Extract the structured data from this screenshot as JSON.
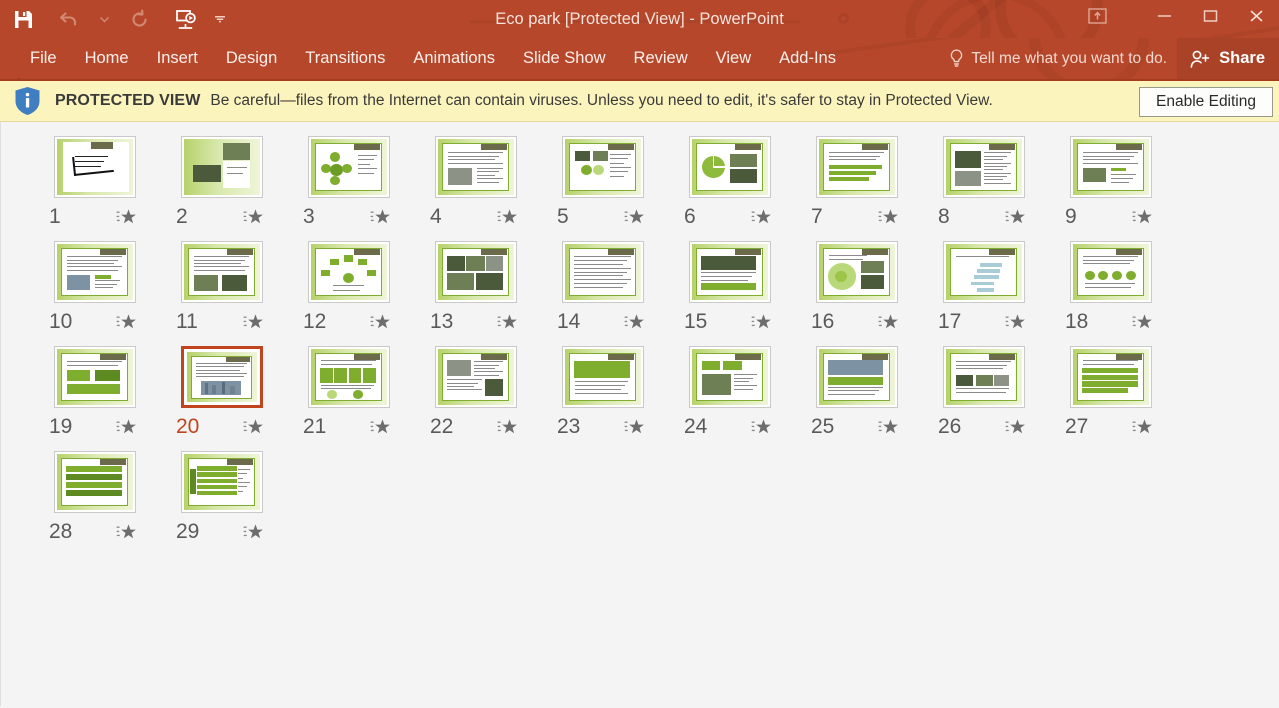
{
  "window": {
    "title": "Eco park [Protected View] - PowerPoint",
    "accent_color": "#b7472a",
    "controls": [
      {
        "name": "ribbon-display-options",
        "glyph": "ribbon"
      },
      {
        "name": "minimize",
        "glyph": "minimize"
      },
      {
        "name": "maximize",
        "glyph": "maximize"
      },
      {
        "name": "close",
        "glyph": "close"
      }
    ]
  },
  "quick_access": [
    {
      "name": "save",
      "label": "Save"
    },
    {
      "name": "undo",
      "label": "Undo",
      "disabled": true
    },
    {
      "name": "undo-dropdown",
      "label": "Undo options",
      "disabled": true
    },
    {
      "name": "redo",
      "label": "Redo",
      "disabled": true
    },
    {
      "name": "start-slideshow",
      "label": "Start From Beginning"
    },
    {
      "name": "customize-qat",
      "label": "Customize Quick Access Toolbar"
    }
  ],
  "ribbon": {
    "tabs": [
      {
        "label": "File",
        "active": false
      },
      {
        "label": "Home",
        "active": false
      },
      {
        "label": "Insert",
        "active": false
      },
      {
        "label": "Design",
        "active": false
      },
      {
        "label": "Transitions",
        "active": false
      },
      {
        "label": "Animations",
        "active": false
      },
      {
        "label": "Slide Show",
        "active": false
      },
      {
        "label": "Review",
        "active": false
      },
      {
        "label": "View",
        "active": false
      },
      {
        "label": "Add-Ins",
        "active": false
      }
    ],
    "tell_me": "Tell me what you want to do.",
    "share_label": "Share"
  },
  "protected_view": {
    "badge": "PROTECTED VIEW",
    "message": "Be careful—files from the Internet can contain viruses. Unless you need to edit, it's safer to stay in Protected View.",
    "button_label": "Enable Editing",
    "background_color": "#fcf4bd",
    "shield_color": "#3f7fc1"
  },
  "slide_sorter": {
    "selected_slide": 20,
    "total_slides": 29,
    "selection_color": "#c0451f",
    "slides": [
      {
        "number": "1",
        "layout": "calligraphy"
      },
      {
        "number": "2",
        "layout": "title-photos"
      },
      {
        "number": "3",
        "layout": "diagram-circles"
      },
      {
        "number": "4",
        "layout": "text-photo-left"
      },
      {
        "number": "5",
        "layout": "text-photos-top"
      },
      {
        "number": "6",
        "layout": "pie-photo"
      },
      {
        "number": "7",
        "layout": "text-green-bars"
      },
      {
        "number": "8",
        "layout": "photo-text-split"
      },
      {
        "number": "9",
        "layout": "text-photo-inline"
      },
      {
        "number": "10",
        "layout": "text-photo-right"
      },
      {
        "number": "11",
        "layout": "text-two-photos"
      },
      {
        "number": "12",
        "layout": "radial-diagram"
      },
      {
        "number": "13",
        "layout": "photo-grid"
      },
      {
        "number": "14",
        "layout": "dense-text"
      },
      {
        "number": "15",
        "layout": "photo-text-block"
      },
      {
        "number": "16",
        "layout": "flower-diagram"
      },
      {
        "number": "17",
        "layout": "flowchart"
      },
      {
        "number": "18",
        "layout": "icons-row"
      },
      {
        "number": "19",
        "layout": "text-green-blocks"
      },
      {
        "number": "20",
        "layout": "text-cityscape"
      },
      {
        "number": "21",
        "layout": "four-boxes"
      },
      {
        "number": "22",
        "layout": "photo-text-mixed"
      },
      {
        "number": "23",
        "layout": "green-panel"
      },
      {
        "number": "24",
        "layout": "boxes-photo"
      },
      {
        "number": "25",
        "layout": "photo-green-text"
      },
      {
        "number": "26",
        "layout": "text-photos-grid"
      },
      {
        "number": "27",
        "layout": "green-list"
      },
      {
        "number": "28",
        "layout": "green-rows"
      },
      {
        "number": "29",
        "layout": "green-bars-list"
      }
    ],
    "star_icon": "animation-star-icon"
  }
}
